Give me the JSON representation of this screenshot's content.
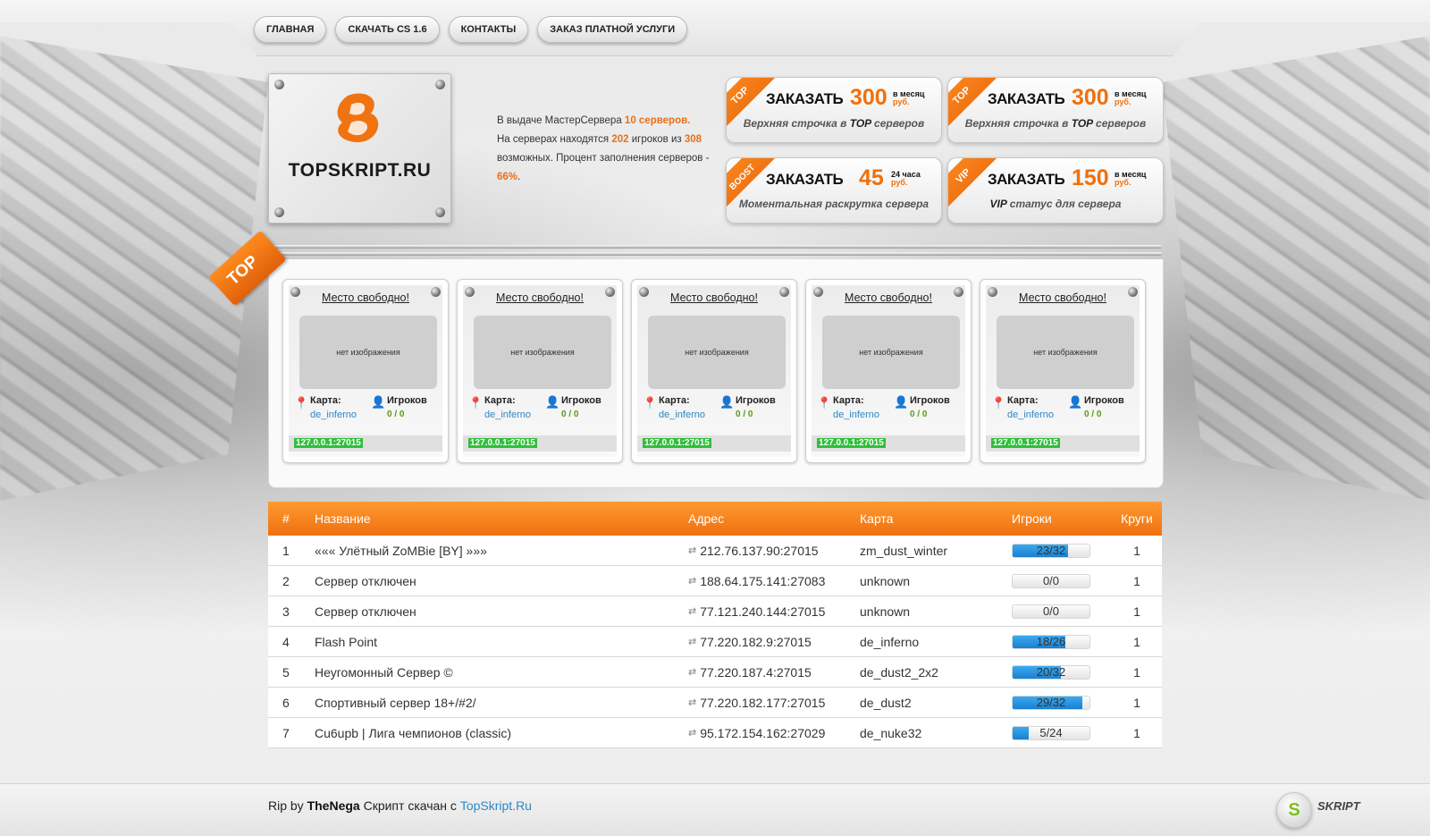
{
  "nav": [
    {
      "label": "ГЛАВНАЯ"
    },
    {
      "label": "СКАЧАТЬ CS 1.6"
    },
    {
      "label": "КОНТАКТЫ"
    },
    {
      "label": "ЗАКАЗ ПЛАТНОЙ УСЛУГИ"
    }
  ],
  "logo": {
    "text": "TOPSKRIPT.RU"
  },
  "stats": {
    "line1_pre": "В выдаче МастерСервера ",
    "servers": "10 серверов.",
    "line2_pre": "На серверах находятся ",
    "players": "202",
    "line2_post": " игроков из",
    "max": "308",
    "line3_post": " возможных. Процент заполнения серверов - ",
    "percent": "66%",
    "end": "."
  },
  "promos": [
    {
      "ribbon": "TOP",
      "order": "ЗАКАЗАТЬ",
      "price": "300",
      "per": "в месяц",
      "rub": "руб.",
      "desc_pre": "Верхняя строчка в ",
      "desc_em": "TOP",
      "desc_post": " серверов"
    },
    {
      "ribbon": "TOP",
      "order": "ЗАКАЗАТЬ",
      "price": "300",
      "per": "в месяц",
      "rub": "руб.",
      "desc_pre": "Верхняя строчка в ",
      "desc_em": "TOP",
      "desc_post": " серверов"
    },
    {
      "ribbon": "BOOST",
      "order": "ЗАКАЗАТЬ",
      "price": "45",
      "per": "24 часа",
      "rub": "руб.",
      "desc_pre": "Моментальная раскрутка сервера",
      "desc_em": "",
      "desc_post": ""
    },
    {
      "ribbon": "VIP",
      "order": "ЗАКАЗАТЬ",
      "price": "150",
      "per": "в месяц",
      "rub": "руб.",
      "desc_pre": "",
      "desc_em": "VIP",
      "desc_post": " статус для сервера"
    }
  ],
  "top_tag": "TOP",
  "cards": [
    {
      "title": "Место свободно!",
      "noimg": "нет изображения",
      "map_label": "Карта:",
      "map": "de_inferno",
      "pl_label": "Игроков",
      "players": "0 / 0",
      "ip": "127.0.0.1:27015"
    },
    {
      "title": "Место свободно!",
      "noimg": "нет изображения",
      "map_label": "Карта:",
      "map": "de_inferno",
      "pl_label": "Игроков",
      "players": "0 / 0",
      "ip": "127.0.0.1:27015"
    },
    {
      "title": "Место свободно!",
      "noimg": "нет изображения",
      "map_label": "Карта:",
      "map": "de_inferno",
      "pl_label": "Игроков",
      "players": "0 / 0",
      "ip": "127.0.0.1:27015"
    },
    {
      "title": "Место свободно!",
      "noimg": "нет изображения",
      "map_label": "Карта:",
      "map": "de_inferno",
      "pl_label": "Игроков",
      "players": "0 / 0",
      "ip": "127.0.0.1:27015"
    },
    {
      "title": "Место свободно!",
      "noimg": "нет изображения",
      "map_label": "Карта:",
      "map": "de_inferno",
      "pl_label": "Игроков",
      "players": "0 / 0",
      "ip": "127.0.0.1:27015"
    }
  ],
  "table": {
    "headers": [
      "#",
      "Название",
      "Адрес",
      "Карта",
      "Игроки",
      "Круги"
    ],
    "rows": [
      {
        "num": "1",
        "name": "««« Улётный ZoMBie [BY] »»»",
        "addr": "212.76.137.90:27015",
        "map": "zm_dust_winter",
        "players": "23/32",
        "fill": 0.72,
        "laps": "1"
      },
      {
        "num": "2",
        "name": "Сервер отключен",
        "addr": "188.64.175.141:27083",
        "map": "unknown",
        "players": "0/0",
        "fill": 0,
        "laps": "1"
      },
      {
        "num": "3",
        "name": "Сервер отключен",
        "addr": "77.121.240.144:27015",
        "map": "unknown",
        "players": "0/0",
        "fill": 0,
        "laps": "1"
      },
      {
        "num": "4",
        "name": "Flash Point",
        "addr": "77.220.182.9:27015",
        "map": "de_inferno",
        "players": "18/26",
        "fill": 0.69,
        "laps": "1"
      },
      {
        "num": "5",
        "name": "Неугомонный Сервер ©",
        "addr": "77.220.187.4:27015",
        "map": "de_dust2_2x2",
        "players": "20/32",
        "fill": 0.63,
        "laps": "1"
      },
      {
        "num": "6",
        "name": "Спортивный сервер 18+/#2/",
        "addr": "77.220.182.177:27015",
        "map": "de_dust2",
        "players": "29/32",
        "fill": 0.91,
        "laps": "1"
      },
      {
        "num": "7",
        "name": "Cu6upb | Лига чемпионов (classic)",
        "addr": "95.172.154.162:27029",
        "map": "de_nuke32",
        "players": "5/24",
        "fill": 0.21,
        "laps": "1"
      }
    ]
  },
  "footer": {
    "pre": "Rip by ",
    "author": "TheNega",
    "mid": " Скрипт скачан с ",
    "link": "TopSkript.Ru",
    "badge": "S",
    "brand": "SKRIPT"
  }
}
